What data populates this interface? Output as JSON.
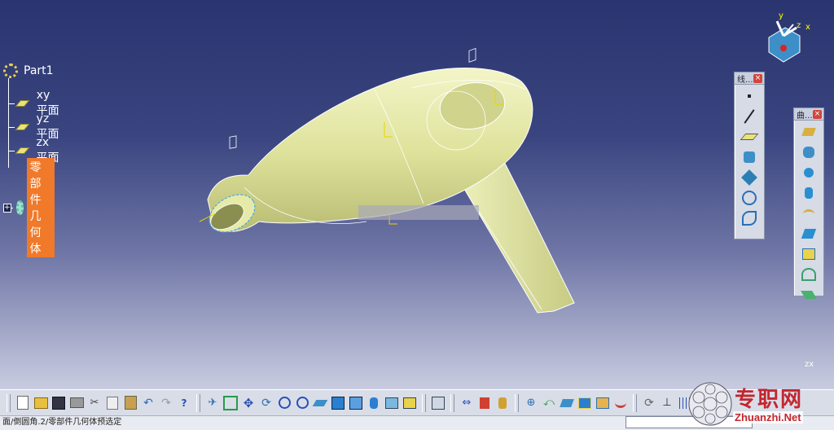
{
  "tree": {
    "root_label": "Part1",
    "items": [
      {
        "label": "xy 平面"
      },
      {
        "label": "yz 平面"
      },
      {
        "label": "zx 平面"
      },
      {
        "label": "零部件几何体"
      }
    ]
  },
  "compass": {
    "x": "x",
    "y": "y",
    "z": "z"
  },
  "axis_small": {
    "label": "zx"
  },
  "palette_wire": {
    "title": "线..."
  },
  "palette_surface": {
    "title": "曲..."
  },
  "status": {
    "message": "面/倒圆角.2/零部件几何体预选定",
    "cmd_value": ""
  },
  "watermark": {
    "cn": "专职网",
    "en": "Zhuanzhi.Net"
  },
  "colors": {
    "background_top": "#2a3570",
    "background_bottom": "#c9cce0",
    "selection": "#f07a2a",
    "model": "#e6eaa8"
  }
}
